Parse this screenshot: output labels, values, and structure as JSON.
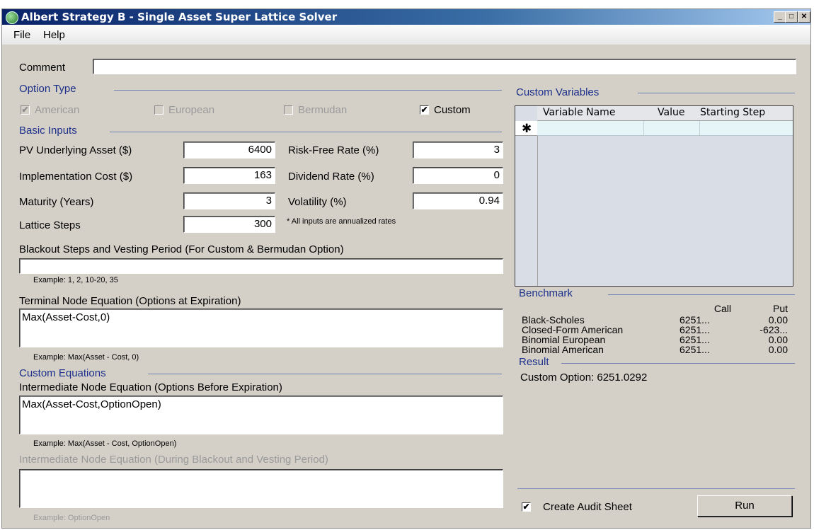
{
  "window": {
    "title": "Albert Strategy B - Single Asset Super Lattice Solver",
    "controls": [
      "_",
      "□",
      "✕"
    ]
  },
  "menu": [
    "File",
    "Help"
  ],
  "comment": {
    "label": "Comment",
    "value": ""
  },
  "option_type": {
    "group_label": "Option Type",
    "options": [
      {
        "label": "American",
        "checked": true,
        "enabled": false
      },
      {
        "label": "European",
        "checked": false,
        "enabled": false
      },
      {
        "label": "Bermudan",
        "checked": false,
        "enabled": false
      },
      {
        "label": "Custom",
        "checked": true,
        "enabled": true
      }
    ]
  },
  "basic_inputs": {
    "group_label": "Basic Inputs",
    "pv_label": "PV Underlying Asset ($)",
    "pv": "6400",
    "cost_label": "Implementation Cost ($)",
    "cost": "163",
    "maturity_label": "Maturity (Years)",
    "maturity": "3",
    "steps_label": "Lattice Steps",
    "steps": "300",
    "rf_label": "Risk-Free Rate (%)",
    "rf": "3",
    "div_label": "Dividend Rate (%)",
    "div": "0",
    "vol_label": "Volatility (%)",
    "vol": "0.94",
    "note": "* All inputs are annualized rates"
  },
  "blackout": {
    "label": "Blackout Steps and Vesting Period (For Custom & Bermudan Option)",
    "value": "",
    "example": "Example: 1, 2, 10-20, 35"
  },
  "terminal": {
    "label": "Terminal Node Equation (Options at Expiration)",
    "value": "Max(Asset-Cost,0)",
    "example": "Example: Max(Asset - Cost, 0)"
  },
  "custom_equations": {
    "group_label": "Custom Equations",
    "intermediate_label": "Intermediate Node Equation (Options Before Expiration)",
    "intermediate_value": "Max(Asset-Cost,OptionOpen)",
    "intermediate_example": "Example: Max(Asset - Cost, OptionOpen)",
    "blackout_label": "Intermediate Node Equation (During Blackout and Vesting Period)",
    "blackout_value": "",
    "blackout_example": "Example: OptionOpen"
  },
  "custom_variables": {
    "group_label": "Custom Variables",
    "columns": [
      "Variable Name",
      "Value",
      "Starting Step"
    ],
    "new_row_marker": "✱"
  },
  "benchmark": {
    "group_label": "Benchmark",
    "call_header": "Call",
    "put_header": "Put",
    "rows": [
      {
        "name": "Black-Scholes",
        "call": "6251...",
        "put": "0.00"
      },
      {
        "name": "Closed-Form American",
        "call": "6251...",
        "put": "-623..."
      },
      {
        "name": "Binomial European",
        "call": "6251...",
        "put": "0.00"
      },
      {
        "name": "Binomial American",
        "call": "6251...",
        "put": "0.00"
      }
    ]
  },
  "result": {
    "group_label": "Result",
    "text": "Custom Option: 6251.0292"
  },
  "audit": {
    "label": "Create Audit Sheet",
    "checked": true
  },
  "run_label": "Run"
}
